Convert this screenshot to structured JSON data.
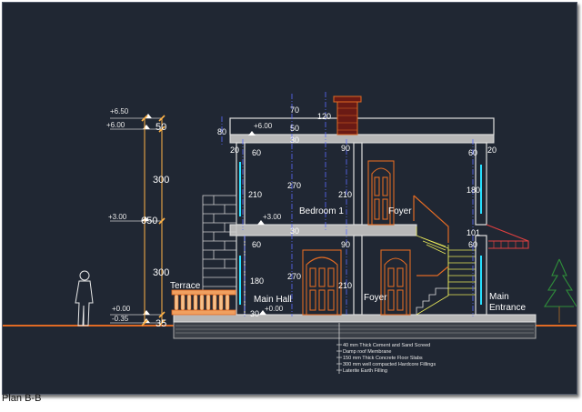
{
  "caption": "Plan B-B",
  "levels": [
    "+6.50",
    "+6.00",
    "+3.00",
    "+0.00",
    "-0.35"
  ],
  "level_inner": {
    "roof": "+6.00",
    "first": "+3.00",
    "ground": "+0.00"
  },
  "left_dims": {
    "parapet": "50",
    "upper": "300",
    "total": "650",
    "lower": "300",
    "plinth": "35"
  },
  "top_dims": {
    "d70": "70",
    "d120": "120",
    "d50": "50",
    "d30a": "30",
    "d80": "80"
  },
  "dims_upper": {
    "d20l": "20",
    "d60l": "60",
    "d90": "90",
    "d60r": "60",
    "d20r": "20",
    "d210l": "210",
    "d270": "270",
    "d210r": "210",
    "d180": "180",
    "d30": "30"
  },
  "dims_lower": {
    "d60l": "60",
    "d90": "90",
    "d60r": "60",
    "d101": "101",
    "d180": "180",
    "d270": "270",
    "d210": "210",
    "d30": "30"
  },
  "rooms": {
    "bedroom": "Bedroom 1",
    "foyer_up": "Foyer",
    "terrace": "Terrace",
    "main_hall": "Main Hall",
    "foyer_down": "Foyer",
    "main_entrance_1": "Main",
    "main_entrance_2": "Entrance"
  },
  "notes": [
    "40 mm Thick Cement and Sand Screed",
    "Damp roof Membrane",
    "150 mm Thick Concrete Floor Slabs",
    "300 mm well compacted Hardcore Fillings",
    "Laterite Earth Filling"
  ],
  "colors": {
    "background": "#202733",
    "wall": "#d9d9d9",
    "door": "#e06a24",
    "dimension": "#ffb347",
    "axis": "#5a6cff",
    "stair": "#e8e85a",
    "tree": "#2f8f3a"
  }
}
